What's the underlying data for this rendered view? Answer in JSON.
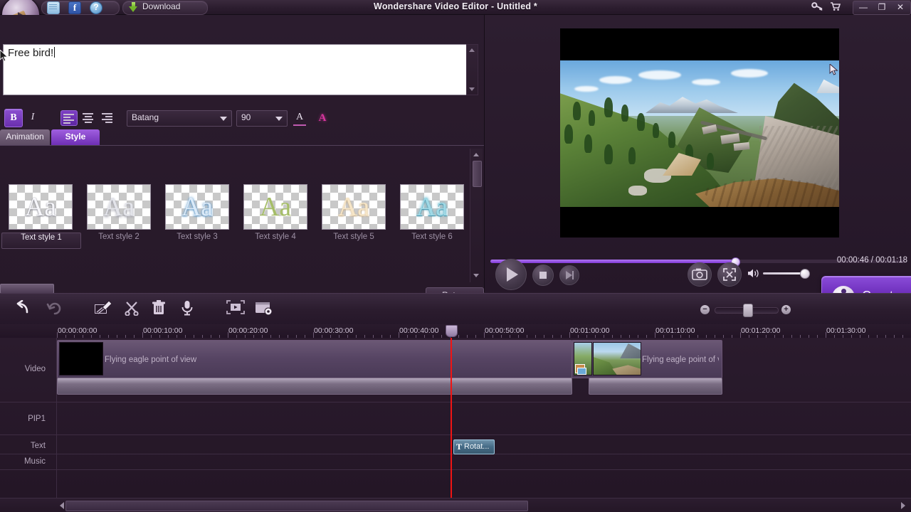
{
  "window": {
    "title": "Wondershare Video Editor - Untitled *",
    "download_label": "Download",
    "icons": {
      "page": "page-icon",
      "facebook": "f",
      "help": "?",
      "key": "⚷",
      "cart": "🛒",
      "minimize": "—",
      "maximize": "❐",
      "close": "✕"
    }
  },
  "text_editor": {
    "value": "Free bird!",
    "format": {
      "bold": "B",
      "italic": "I",
      "align_left": "align-left",
      "align_center": "align-center",
      "align_right": "align-right",
      "font_family": "Batang",
      "font_size": "90",
      "underline_color": "A",
      "text_color": "A"
    },
    "tabs": [
      {
        "label": "Animation",
        "active": false
      },
      {
        "label": "Style",
        "active": true
      }
    ],
    "styles": [
      {
        "label": "Text style 1",
        "selected": true,
        "color": "#e9e9ef"
      },
      {
        "label": "Text style 2",
        "selected": false,
        "color": "#dcdde4"
      },
      {
        "label": "Text style 3",
        "selected": false,
        "color": "#cfe2f2"
      },
      {
        "label": "Text style 4",
        "selected": false,
        "color": "#a8bf6e"
      },
      {
        "label": "Text style 5",
        "selected": false,
        "color": "#f3ddb6"
      },
      {
        "label": "Text style 6",
        "selected": false,
        "color": "#8fd4e3"
      }
    ],
    "style_glyph": "Aa",
    "return_label": "Return"
  },
  "preview": {
    "current_time": "00:00:46",
    "total_time": "00:01:18",
    "time_separator": "/",
    "controls": {
      "play": "play-icon",
      "stop": "stop-icon",
      "step": "step-forward-icon",
      "snapshot": "camera-icon",
      "fullscreen": "fullscreen-icon",
      "volume": "speaker-icon"
    },
    "seek_percent": 59,
    "volume_percent": 82
  },
  "create_button": {
    "label": "Create",
    "icon": "film-reel-icon",
    "accent": "#7a36c4"
  },
  "timeline": {
    "toolbar": [
      {
        "name": "undo-button",
        "glyph": "↶",
        "enabled": true
      },
      {
        "name": "redo-button",
        "glyph": "↻",
        "enabled": false
      },
      {
        "name": "edit-button",
        "glyph": "✎",
        "enabled": true
      },
      {
        "name": "split-button",
        "glyph": "✂",
        "enabled": true
      },
      {
        "name": "delete-button",
        "glyph": "🗑",
        "enabled": true
      },
      {
        "name": "voiceover-button",
        "glyph": "🎤",
        "enabled": true
      },
      {
        "name": "crop-button",
        "glyph": "▣",
        "enabled": true
      },
      {
        "name": "settings-button",
        "glyph": "⚙",
        "enabled": true
      }
    ],
    "zoom": {
      "minus": "−",
      "plus": "+",
      "value": 45
    },
    "ruler_labels": [
      "00:00:00:00",
      "00:00:10:00",
      "00:00:20:00",
      "00:00:30:00",
      "00:00:40:00",
      "00:00:50:00",
      "00:01:00:00",
      "00:01:10:00",
      "00:01:20:00",
      "00:01:30:00"
    ],
    "tracks": [
      {
        "label": "Video"
      },
      {
        "label": "PIP1"
      },
      {
        "label": "Text"
      },
      {
        "label": "Music"
      }
    ],
    "video_clips": [
      {
        "name": "Flying eagle point of view"
      },
      {
        "name": "Flying eagle point of vi..."
      }
    ],
    "text_clips": [
      {
        "icon": "T",
        "name": "Rotat..."
      }
    ],
    "playhead_time": "00:00:40:00"
  }
}
